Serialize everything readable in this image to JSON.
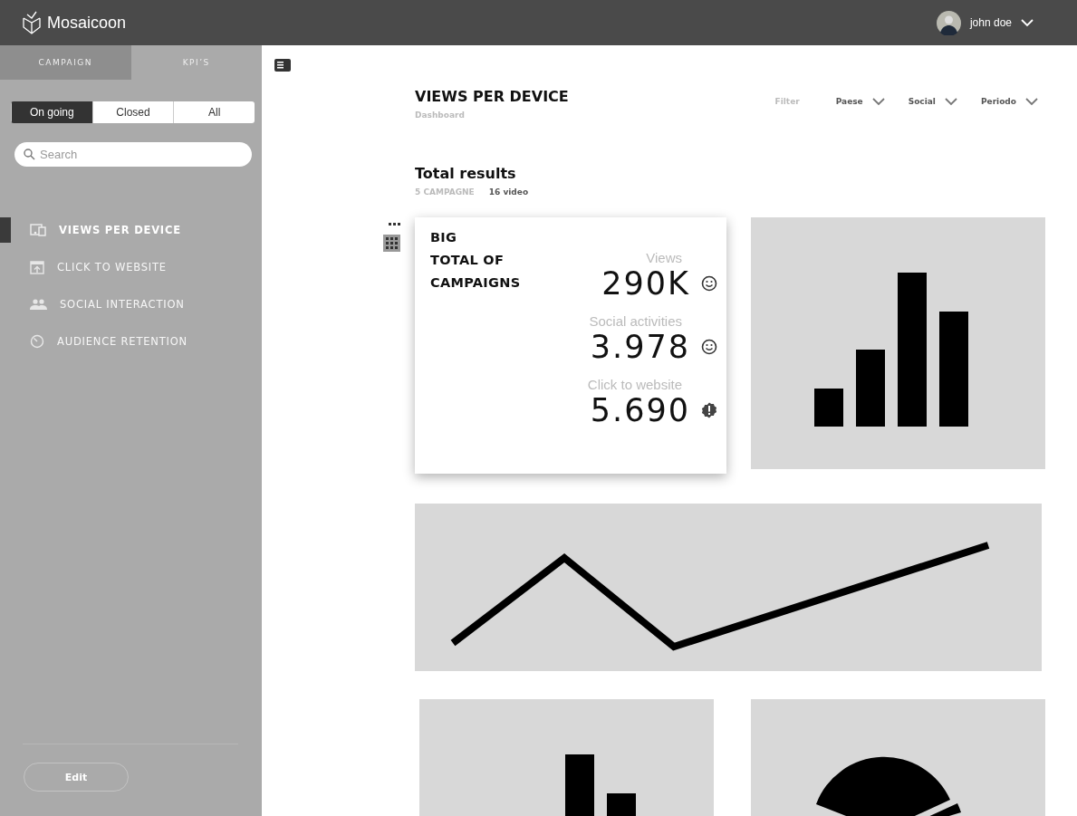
{
  "header": {
    "brand": "Mosaicoon",
    "user": {
      "name": "john doe"
    }
  },
  "sidebar": {
    "tabs": [
      {
        "label": "CAMPAIGN",
        "selected": true
      },
      {
        "label": "KPI’S",
        "selected": false
      }
    ],
    "segments": [
      {
        "label": "On going",
        "selected": true
      },
      {
        "label": "Closed",
        "selected": false
      },
      {
        "label": "All",
        "selected": false
      }
    ],
    "search": {
      "placeholder": "Search"
    },
    "items": [
      {
        "label": "VIEWS PER DEVICE",
        "kind": "devices",
        "selected": true
      },
      {
        "label": "CLICK TO WEBSITE",
        "kind": "upload",
        "selected": false
      },
      {
        "label": "SOCIAL INTERACTION",
        "kind": "people",
        "selected": false
      },
      {
        "label": "AUDIENCE RETENTION",
        "kind": "timer",
        "selected": false
      }
    ],
    "edit_button": "Edit"
  },
  "page": {
    "title": "VIEWS PER DEVICE",
    "subtitle": "Dashboard",
    "filters": {
      "label": "Filter",
      "dropdowns": [
        "Paese",
        "Social",
        "Periodo"
      ]
    },
    "section": {
      "title": "Total results",
      "campaigns": "5 CAMPAGNE",
      "videos": "16 video"
    },
    "summary": {
      "title_lines": [
        "BIG",
        "TOTAL OF",
        "CAMPAIGNS"
      ],
      "metrics": [
        {
          "label": "Views",
          "value": "290K",
          "kind": "good"
        },
        {
          "label": "Social activities",
          "value": "3.978",
          "kind": "good"
        },
        {
          "label": "Click to website",
          "value": "5.690",
          "kind": "alert"
        }
      ]
    }
  }
}
